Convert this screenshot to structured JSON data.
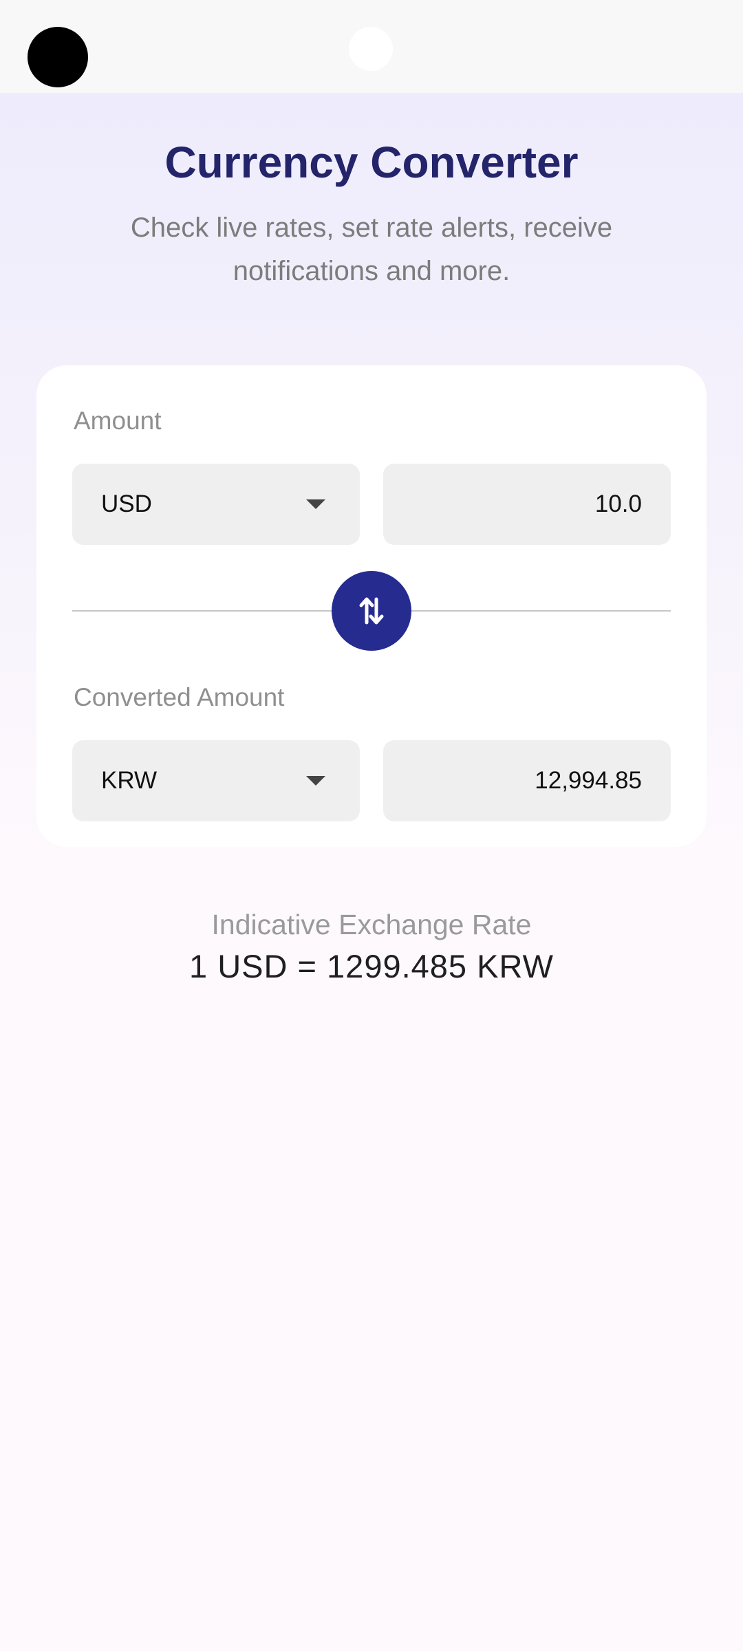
{
  "header": {
    "title": "Currency Converter",
    "subtitle": "Check live rates, set rate alerts, receive notifications and more."
  },
  "converter": {
    "amount_label": "Amount",
    "from_currency": "USD",
    "amount_value": "10.0",
    "converted_label": "Converted Amount",
    "to_currency": "KRW",
    "converted_value": "12,994.85",
    "swap_icon": "swap-vertical-icon"
  },
  "rate": {
    "label": "Indicative Exchange Rate",
    "value": "1 USD = 1299.485 KRW"
  },
  "colors": {
    "title": "#23246a",
    "accent": "#262b8f",
    "field_bg": "#efefef"
  }
}
